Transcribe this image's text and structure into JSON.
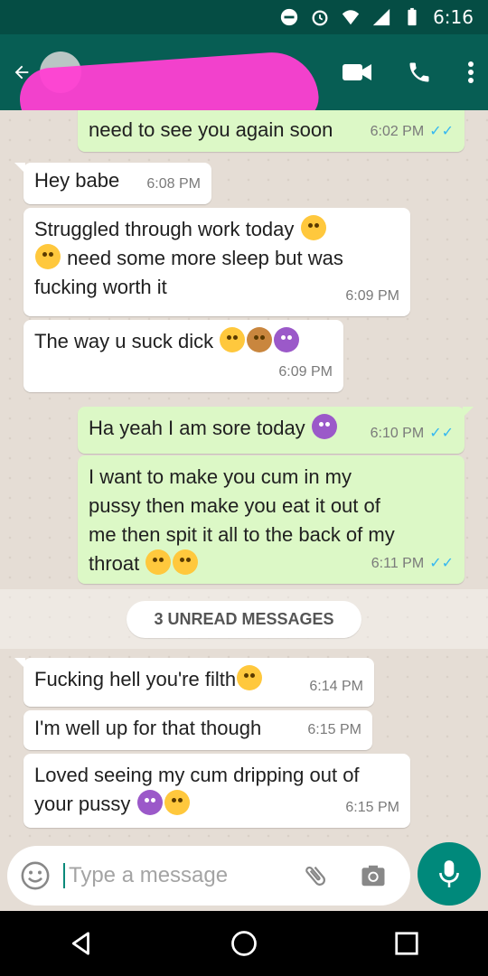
{
  "status": {
    "time": "6:16"
  },
  "header": {
    "contact_name": "",
    "contact_subtitle": ""
  },
  "messages": [
    {
      "dir": "out",
      "text": "need to see you again soon",
      "time": "6:02 PM",
      "ticks": "read"
    },
    {
      "dir": "in",
      "text": "Hey babe",
      "time": "6:08 PM"
    },
    {
      "dir": "in",
      "text_1": "Struggled through work today",
      "text_2": "need some more sleep but was",
      "text_3": "fucking worth it",
      "time": "6:09 PM"
    },
    {
      "dir": "in",
      "text": "The way u suck dick",
      "time": "6:09 PM"
    },
    {
      "dir": "out",
      "text": "Ha yeah I am sore today",
      "time": "6:10 PM",
      "ticks": "read"
    },
    {
      "dir": "out",
      "text_1": "I want to make you cum in my",
      "text_2": "pussy then make you eat it out of",
      "text_3": "me then spit it all to the back of my",
      "text_4": "throat",
      "time": "6:11 PM",
      "ticks": "read"
    },
    {
      "dir": "in",
      "text": "Fucking hell you're filth",
      "time": "6:14 PM"
    },
    {
      "dir": "in",
      "text": "I'm well up for that though",
      "time": "6:15 PM"
    },
    {
      "dir": "in",
      "text_1": "Loved seeing my cum dripping out of",
      "text_2": "your pussy",
      "time": "6:15 PM"
    }
  ],
  "unread_banner": "3 UNREAD MESSAGES",
  "composer": {
    "placeholder": "Type a message"
  },
  "icons": [
    "back-arrow-icon",
    "video-call-icon",
    "phone-icon",
    "more-vert-icon",
    "emoji-icon",
    "attach-icon",
    "camera-icon",
    "mic-icon",
    "nav-back-icon",
    "nav-home-icon",
    "nav-recents-icon"
  ],
  "colors": {
    "header": "#075e54",
    "status": "#054d44",
    "outgoing": "#dcf8c6",
    "incoming": "#ffffff",
    "accent": "#00897b",
    "redaction": "#ff3fd3"
  }
}
